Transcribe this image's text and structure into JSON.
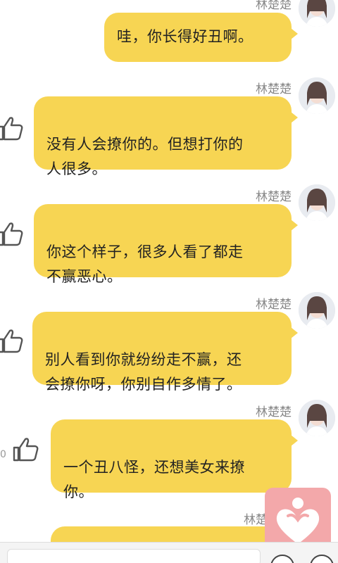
{
  "messages": [
    {
      "sender": "林楚楚",
      "text": "哇，你长得好丑啊。"
    },
    {
      "sender": "林楚楚",
      "text": "没有人会撩你的。但想打你的\n人很多。"
    },
    {
      "sender": "林楚楚",
      "text": "你这个样子，很多人看了都走\n不赢恶心。"
    },
    {
      "sender": "林楚楚",
      "text": "别人看到你就纷纷走不赢，还\n会撩你呀，你别自作多情了。"
    },
    {
      "sender": "林楚楚",
      "text": "一个丑八怪，还想美女来撩\n你。"
    },
    {
      "sender": "林楚"
    }
  ],
  "likes": [
    {
      "count": ""
    },
    {
      "count": ""
    },
    {
      "count": ""
    },
    {
      "count": "0"
    }
  ],
  "icons": {
    "like": "thumbs-up-icon",
    "heart": "heart-icon",
    "avatar": "avatar-image"
  },
  "colors": {
    "bubble": "#f7d553",
    "heart_button": "#f3a8aa",
    "name_text": "#888888"
  }
}
